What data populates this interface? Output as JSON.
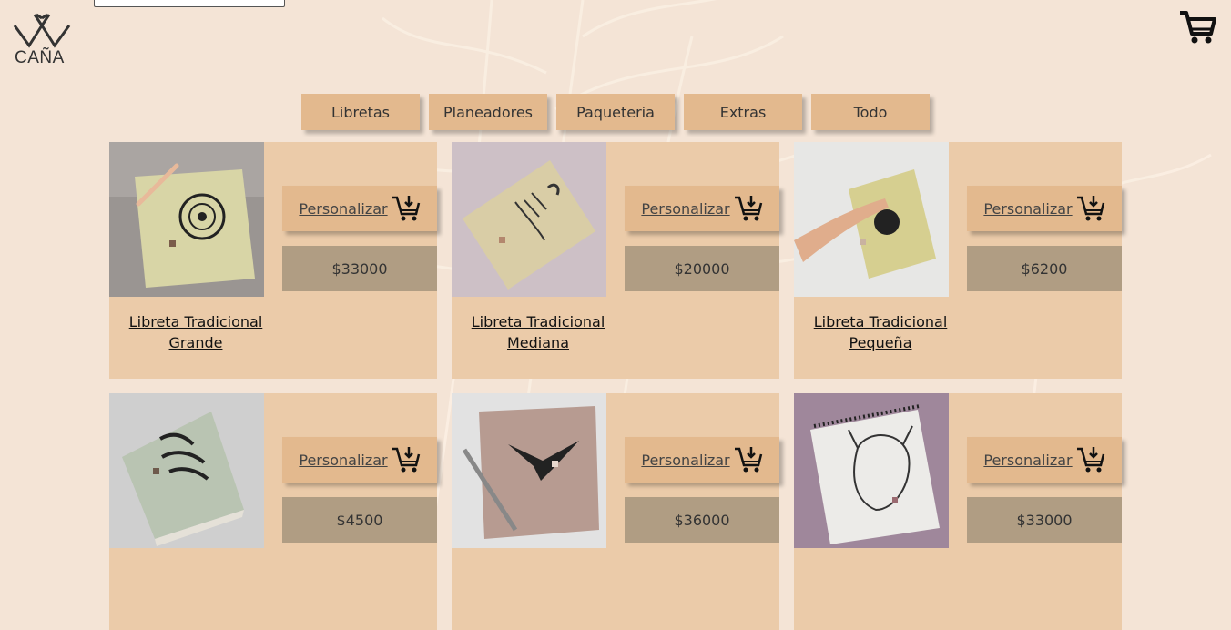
{
  "brand": {
    "name": "CAÑA"
  },
  "nav": {
    "tabs": [
      "Libretas",
      "Planeadores",
      "Paqueteria",
      "Extras",
      "Todo"
    ]
  },
  "products": [
    {
      "name": "Libreta Tradicional Grande",
      "price": "$33000",
      "button": "Personalizar"
    },
    {
      "name": "Libreta Tradicional Mediana",
      "price": "$20000",
      "button": "Personalizar"
    },
    {
      "name": "Libreta Tradicional Pequeña",
      "price": "$6200",
      "button": "Personalizar"
    },
    {
      "name": "",
      "price": "$4500",
      "button": "Personalizar"
    },
    {
      "name": "",
      "price": "$36000",
      "button": "Personalizar"
    },
    {
      "name": "",
      "price": "$33000",
      "button": "Personalizar"
    }
  ],
  "icons": {
    "cart": "shopping-cart-icon",
    "add_to_cart": "cart-add-icon"
  },
  "colors": {
    "background": "#f4e4d6",
    "card": "#ebcba9",
    "button": "#e3b98e",
    "price": "#b09d83"
  }
}
